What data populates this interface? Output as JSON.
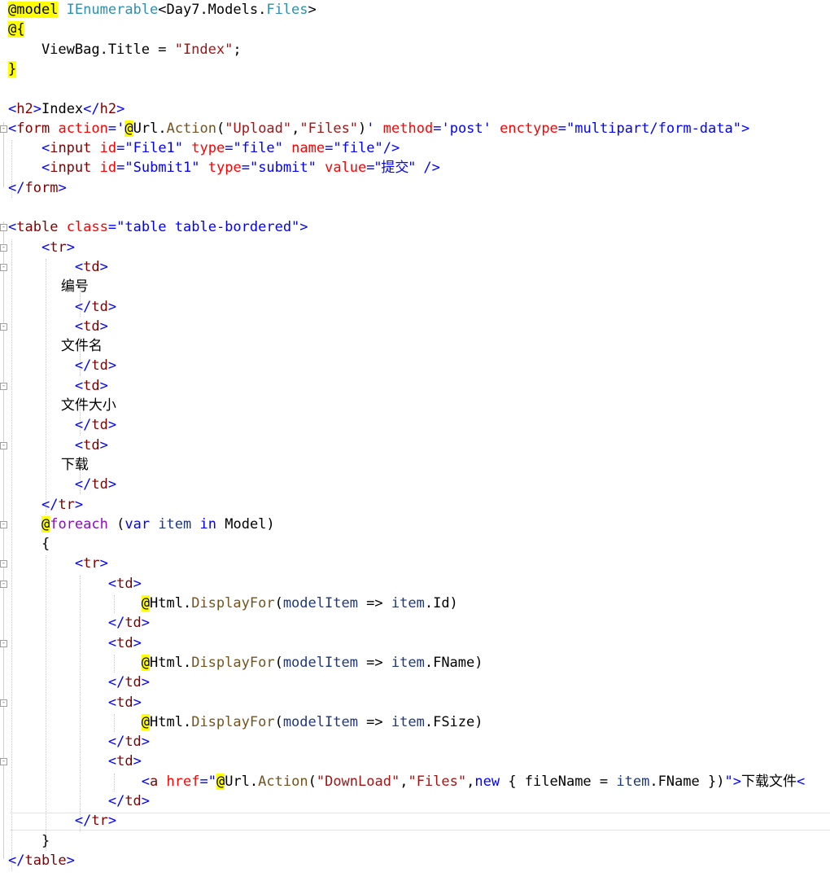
{
  "editor": {
    "lines": [
      [
        {
          "c": "rz",
          "s": "@model"
        },
        {
          "c": "cn",
          "s": " "
        },
        {
          "c": "ty",
          "s": "IEnumerable"
        },
        {
          "c": "cn",
          "s": "<Day7.Models."
        },
        {
          "c": "ty",
          "s": "Files"
        },
        {
          "c": "cn",
          "s": ">"
        }
      ],
      [
        {
          "c": "rz",
          "s": "@{"
        }
      ],
      [
        {
          "c": "cn",
          "s": "    ViewBag.Title = "
        },
        {
          "c": "st",
          "s": "\"Index\""
        },
        {
          "c": "cn",
          "s": ";"
        }
      ],
      [
        {
          "c": "rz",
          "s": "}"
        }
      ],
      [],
      [
        {
          "c": "br",
          "s": "<"
        },
        {
          "c": "el",
          "s": "h2"
        },
        {
          "c": "br",
          "s": ">"
        },
        {
          "c": "cn",
          "s": "Index"
        },
        {
          "c": "br",
          "s": "</"
        },
        {
          "c": "el",
          "s": "h2"
        },
        {
          "c": "br",
          "s": ">"
        }
      ],
      [
        {
          "c": "br",
          "s": "<"
        },
        {
          "c": "el",
          "s": "form"
        },
        {
          "c": "cn",
          "s": " "
        },
        {
          "c": "at",
          "s": "action"
        },
        {
          "c": "br",
          "s": "="
        },
        {
          "c": "av",
          "s": "'"
        },
        {
          "c": "rz",
          "s": "@"
        },
        {
          "c": "cn",
          "s": "Url."
        },
        {
          "c": "me",
          "s": "Action"
        },
        {
          "c": "cn",
          "s": "("
        },
        {
          "c": "st",
          "s": "\"Upload\""
        },
        {
          "c": "cn",
          "s": ","
        },
        {
          "c": "st",
          "s": "\"Files\""
        },
        {
          "c": "cn",
          "s": ")"
        },
        {
          "c": "av",
          "s": "'"
        },
        {
          "c": "cn",
          "s": " "
        },
        {
          "c": "at",
          "s": "method"
        },
        {
          "c": "br",
          "s": "="
        },
        {
          "c": "av",
          "s": "'post'"
        },
        {
          "c": "cn",
          "s": " "
        },
        {
          "c": "at",
          "s": "enctype"
        },
        {
          "c": "br",
          "s": "="
        },
        {
          "c": "av",
          "s": "\"multipart/form-data\""
        },
        {
          "c": "br",
          "s": ">"
        }
      ],
      [
        {
          "c": "cn",
          "s": "    "
        },
        {
          "c": "br",
          "s": "<"
        },
        {
          "c": "el",
          "s": "input"
        },
        {
          "c": "cn",
          "s": " "
        },
        {
          "c": "at",
          "s": "id"
        },
        {
          "c": "br",
          "s": "="
        },
        {
          "c": "av",
          "s": "\"File1\""
        },
        {
          "c": "cn",
          "s": " "
        },
        {
          "c": "at",
          "s": "type"
        },
        {
          "c": "br",
          "s": "="
        },
        {
          "c": "av",
          "s": "\"file\""
        },
        {
          "c": "cn",
          "s": " "
        },
        {
          "c": "at",
          "s": "name"
        },
        {
          "c": "br",
          "s": "="
        },
        {
          "c": "av",
          "s": "\"file\""
        },
        {
          "c": "br",
          "s": "/>"
        }
      ],
      [
        {
          "c": "cn",
          "s": "    "
        },
        {
          "c": "br",
          "s": "<"
        },
        {
          "c": "el",
          "s": "input"
        },
        {
          "c": "cn",
          "s": " "
        },
        {
          "c": "at",
          "s": "id"
        },
        {
          "c": "br",
          "s": "="
        },
        {
          "c": "av",
          "s": "\"Submit1\""
        },
        {
          "c": "cn",
          "s": " "
        },
        {
          "c": "at",
          "s": "type"
        },
        {
          "c": "br",
          "s": "="
        },
        {
          "c": "av",
          "s": "\"submit\""
        },
        {
          "c": "cn",
          "s": " "
        },
        {
          "c": "at",
          "s": "value"
        },
        {
          "c": "br",
          "s": "="
        },
        {
          "c": "av",
          "s": "\"提交\""
        },
        {
          "c": "cn",
          "s": " "
        },
        {
          "c": "br",
          "s": "/>"
        }
      ],
      [
        {
          "c": "br",
          "s": "</"
        },
        {
          "c": "el",
          "s": "form"
        },
        {
          "c": "br",
          "s": ">"
        }
      ],
      [],
      [
        {
          "c": "br",
          "s": "<"
        },
        {
          "c": "el",
          "s": "table"
        },
        {
          "c": "cn",
          "s": " "
        },
        {
          "c": "at",
          "s": "class"
        },
        {
          "c": "br",
          "s": "="
        },
        {
          "c": "av",
          "s": "\"table table-bordered\""
        },
        {
          "c": "br",
          "s": ">"
        }
      ],
      [
        {
          "c": "cn",
          "s": "    "
        },
        {
          "c": "br",
          "s": "<"
        },
        {
          "c": "el",
          "s": "tr"
        },
        {
          "c": "br",
          "s": ">"
        }
      ],
      [
        {
          "c": "cn",
          "s": "        "
        },
        {
          "c": "br",
          "s": "<"
        },
        {
          "c": "el",
          "s": "td"
        },
        {
          "c": "br",
          "s": ">"
        }
      ],
      [
        {
          "c": "cn",
          "s": "            编号"
        }
      ],
      [
        {
          "c": "cn",
          "s": "        "
        },
        {
          "c": "br",
          "s": "</"
        },
        {
          "c": "el",
          "s": "td"
        },
        {
          "c": "br",
          "s": ">"
        }
      ],
      [
        {
          "c": "cn",
          "s": "        "
        },
        {
          "c": "br",
          "s": "<"
        },
        {
          "c": "el",
          "s": "td"
        },
        {
          "c": "br",
          "s": ">"
        }
      ],
      [
        {
          "c": "cn",
          "s": "            文件名"
        }
      ],
      [
        {
          "c": "cn",
          "s": "        "
        },
        {
          "c": "br",
          "s": "</"
        },
        {
          "c": "el",
          "s": "td"
        },
        {
          "c": "br",
          "s": ">"
        }
      ],
      [
        {
          "c": "cn",
          "s": "        "
        },
        {
          "c": "br",
          "s": "<"
        },
        {
          "c": "el",
          "s": "td"
        },
        {
          "c": "br",
          "s": ">"
        }
      ],
      [
        {
          "c": "cn",
          "s": "            文件大小"
        }
      ],
      [
        {
          "c": "cn",
          "s": "        "
        },
        {
          "c": "br",
          "s": "</"
        },
        {
          "c": "el",
          "s": "td"
        },
        {
          "c": "br",
          "s": ">"
        }
      ],
      [
        {
          "c": "cn",
          "s": "        "
        },
        {
          "c": "br",
          "s": "<"
        },
        {
          "c": "el",
          "s": "td"
        },
        {
          "c": "br",
          "s": ">"
        }
      ],
      [
        {
          "c": "cn",
          "s": "            下载"
        }
      ],
      [
        {
          "c": "cn",
          "s": "        "
        },
        {
          "c": "br",
          "s": "</"
        },
        {
          "c": "el",
          "s": "td"
        },
        {
          "c": "br",
          "s": ">"
        }
      ],
      [
        {
          "c": "cn",
          "s": "    "
        },
        {
          "c": "br",
          "s": "</"
        },
        {
          "c": "el",
          "s": "tr"
        },
        {
          "c": "br",
          "s": ">"
        }
      ],
      [
        {
          "c": "cn",
          "s": "    "
        },
        {
          "c": "rz",
          "s": "@"
        },
        {
          "c": "ctl",
          "s": "foreach"
        },
        {
          "c": "cn",
          "s": " ("
        },
        {
          "c": "kw",
          "s": "var"
        },
        {
          "c": "cn",
          "s": " "
        },
        {
          "c": "pa",
          "s": "item"
        },
        {
          "c": "cn",
          "s": " "
        },
        {
          "c": "kw",
          "s": "in"
        },
        {
          "c": "cn",
          "s": " Model)"
        }
      ],
      [
        {
          "c": "cn",
          "s": "    {"
        }
      ],
      [
        {
          "c": "cn",
          "s": "        "
        },
        {
          "c": "br",
          "s": "<"
        },
        {
          "c": "el",
          "s": "tr"
        },
        {
          "c": "br",
          "s": ">"
        }
      ],
      [
        {
          "c": "cn",
          "s": "            "
        },
        {
          "c": "br",
          "s": "<"
        },
        {
          "c": "el",
          "s": "td"
        },
        {
          "c": "br",
          "s": ">"
        }
      ],
      [
        {
          "c": "cn",
          "s": "                "
        },
        {
          "c": "rz",
          "s": "@"
        },
        {
          "c": "cn",
          "s": "Html."
        },
        {
          "c": "me",
          "s": "DisplayFor"
        },
        {
          "c": "cn",
          "s": "("
        },
        {
          "c": "pa",
          "s": "modelItem"
        },
        {
          "c": "cn",
          "s": " => "
        },
        {
          "c": "pa",
          "s": "item"
        },
        {
          "c": "cn",
          "s": ".Id)"
        }
      ],
      [
        {
          "c": "cn",
          "s": "            "
        },
        {
          "c": "br",
          "s": "</"
        },
        {
          "c": "el",
          "s": "td"
        },
        {
          "c": "br",
          "s": ">"
        }
      ],
      [
        {
          "c": "cn",
          "s": "            "
        },
        {
          "c": "br",
          "s": "<"
        },
        {
          "c": "el",
          "s": "td"
        },
        {
          "c": "br",
          "s": ">"
        }
      ],
      [
        {
          "c": "cn",
          "s": "                "
        },
        {
          "c": "rz",
          "s": "@"
        },
        {
          "c": "cn",
          "s": "Html."
        },
        {
          "c": "me",
          "s": "DisplayFor"
        },
        {
          "c": "cn",
          "s": "("
        },
        {
          "c": "pa",
          "s": "modelItem"
        },
        {
          "c": "cn",
          "s": " => "
        },
        {
          "c": "pa",
          "s": "item"
        },
        {
          "c": "cn",
          "s": ".FName)"
        }
      ],
      [
        {
          "c": "cn",
          "s": "            "
        },
        {
          "c": "br",
          "s": "</"
        },
        {
          "c": "el",
          "s": "td"
        },
        {
          "c": "br",
          "s": ">"
        }
      ],
      [
        {
          "c": "cn",
          "s": "            "
        },
        {
          "c": "br",
          "s": "<"
        },
        {
          "c": "el",
          "s": "td"
        },
        {
          "c": "br",
          "s": ">"
        }
      ],
      [
        {
          "c": "cn",
          "s": "                "
        },
        {
          "c": "rz",
          "s": "@"
        },
        {
          "c": "cn",
          "s": "Html."
        },
        {
          "c": "me",
          "s": "DisplayFor"
        },
        {
          "c": "cn",
          "s": "("
        },
        {
          "c": "pa",
          "s": "modelItem"
        },
        {
          "c": "cn",
          "s": " => "
        },
        {
          "c": "pa",
          "s": "item"
        },
        {
          "c": "cn",
          "s": ".FSize)"
        }
      ],
      [
        {
          "c": "cn",
          "s": "            "
        },
        {
          "c": "br",
          "s": "</"
        },
        {
          "c": "el",
          "s": "td"
        },
        {
          "c": "br",
          "s": ">"
        }
      ],
      [
        {
          "c": "cn",
          "s": "            "
        },
        {
          "c": "br",
          "s": "<"
        },
        {
          "c": "el",
          "s": "td"
        },
        {
          "c": "br",
          "s": ">"
        }
      ],
      [
        {
          "c": "cn",
          "s": "                "
        },
        {
          "c": "br",
          "s": "<"
        },
        {
          "c": "el",
          "s": "a"
        },
        {
          "c": "cn",
          "s": " "
        },
        {
          "c": "at",
          "s": "href"
        },
        {
          "c": "br",
          "s": "="
        },
        {
          "c": "av",
          "s": "\""
        },
        {
          "c": "rz",
          "s": "@"
        },
        {
          "c": "cn",
          "s": "Url."
        },
        {
          "c": "me",
          "s": "Action"
        },
        {
          "c": "cn",
          "s": "("
        },
        {
          "c": "st",
          "s": "\"DownLoad\""
        },
        {
          "c": "cn",
          "s": ","
        },
        {
          "c": "st",
          "s": "\"Files\""
        },
        {
          "c": "cn",
          "s": ","
        },
        {
          "c": "kw",
          "s": "new"
        },
        {
          "c": "cn",
          "s": " { fileName = "
        },
        {
          "c": "pa",
          "s": "item"
        },
        {
          "c": "cn",
          "s": ".FName })"
        },
        {
          "c": "av",
          "s": "\""
        },
        {
          "c": "br",
          "s": ">"
        },
        {
          "c": "cn",
          "s": "下载文件"
        },
        {
          "c": "br",
          "s": "<"
        }
      ],
      [
        {
          "c": "cn",
          "s": "            "
        },
        {
          "c": "br",
          "s": "</"
        },
        {
          "c": "el",
          "s": "td"
        },
        {
          "c": "br",
          "s": ">"
        }
      ],
      [
        {
          "c": "cn",
          "s": "        "
        },
        {
          "c": "br",
          "s": "</"
        },
        {
          "c": "el",
          "s": "tr"
        },
        {
          "c": "br",
          "s": ">"
        }
      ],
      [
        {
          "c": "cn",
          "s": "    }"
        }
      ],
      [
        {
          "c": "br",
          "s": "</"
        },
        {
          "c": "el",
          "s": "table"
        },
        {
          "c": "br",
          "s": ">"
        }
      ]
    ],
    "collapse_glyph": "-"
  },
  "colors": {
    "razor_highlight": "#ffff00",
    "element": "#800000",
    "attribute": "#ff0000",
    "attribute_value": "#0000ff",
    "string": "#a31515",
    "keyword": "#0000ff",
    "type": "#2b91af",
    "method": "#74531f",
    "parameter": "#1f377f",
    "control_keyword": "#8f08c4"
  }
}
